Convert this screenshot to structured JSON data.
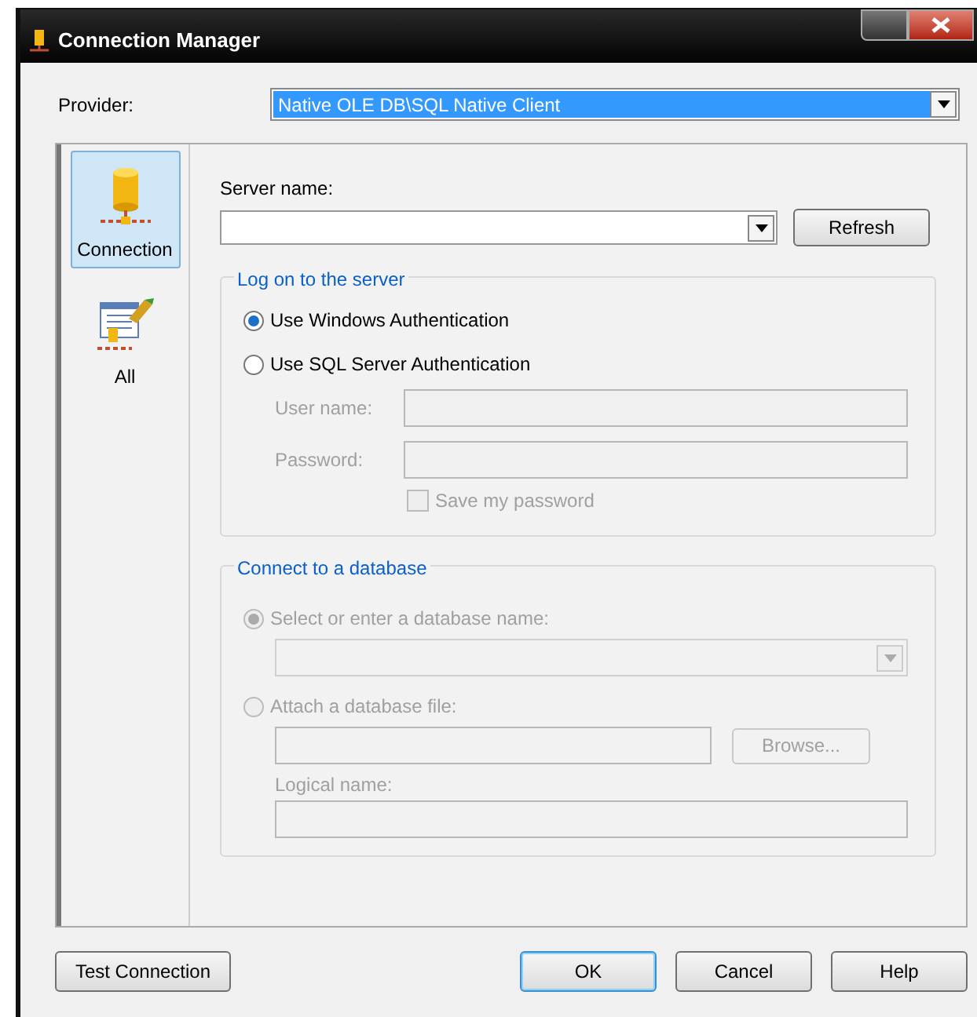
{
  "window": {
    "title": "Connection Manager"
  },
  "provider": {
    "label": "Provider:",
    "value": "Native OLE DB\\SQL Native Client"
  },
  "sidebar": {
    "items": [
      {
        "label": "Connection",
        "kind": "connection",
        "selected": true
      },
      {
        "label": "All",
        "kind": "all",
        "selected": false
      }
    ]
  },
  "server_name": {
    "label": "Server name:",
    "button": "Refresh"
  },
  "logon": {
    "title": "Log on to the server",
    "options": [
      {
        "label": "Use Windows Authentication",
        "selected": true
      },
      {
        "label": "Use SQL Server Authentication",
        "selected": false
      }
    ],
    "fields": [
      {
        "label": "User name:",
        "disabled": true
      },
      {
        "label": "Password:",
        "disabled": true
      }
    ],
    "save_password": {
      "label": "Save my password",
      "checked": false,
      "disabled": true
    }
  },
  "database": {
    "title": "Connect to a database",
    "disabled": true,
    "options": [
      {
        "label": "Select or enter a database name:",
        "selected": true,
        "kind": "combo"
      },
      {
        "label": "Attach a database file:",
        "selected": false,
        "kind": "file"
      }
    ],
    "browse": "Browse...",
    "logical_name": "Logical name:"
  },
  "buttons": [
    {
      "label": "Test Connection",
      "default": false
    },
    {
      "label": "OK",
      "default": true
    },
    {
      "label": "Cancel",
      "default": false
    },
    {
      "label": "Help",
      "default": false
    }
  ]
}
